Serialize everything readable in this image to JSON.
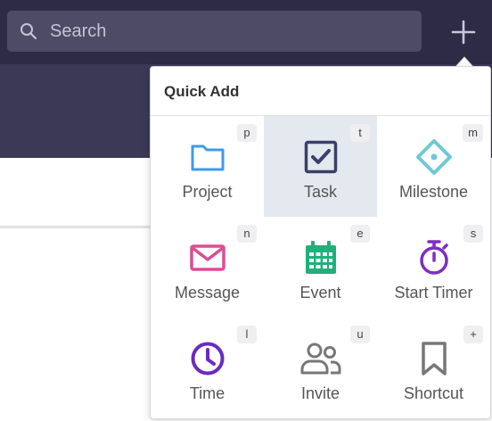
{
  "search": {
    "placeholder": "Search",
    "icon": "search-icon"
  },
  "header": {
    "add_icon": "plus-icon"
  },
  "quick_add": {
    "title": "Quick Add",
    "items": [
      {
        "label": "Project",
        "shortcut": "p",
        "icon": "folder-icon",
        "color": "#3d9be9",
        "active": false
      },
      {
        "label": "Task",
        "shortcut": "t",
        "icon": "checkbox-icon",
        "color": "#3a3f6a",
        "active": true
      },
      {
        "label": "Milestone",
        "shortcut": "m",
        "icon": "milestone-diamond-icon",
        "color": "#6ec9d4",
        "active": false
      },
      {
        "label": "Message",
        "shortcut": "n",
        "icon": "envelope-icon",
        "color": "#db4d94",
        "active": false
      },
      {
        "label": "Event",
        "shortcut": "e",
        "icon": "calendar-icon",
        "color": "#20b07a",
        "active": false
      },
      {
        "label": "Start Timer",
        "shortcut": "s",
        "icon": "stopwatch-icon",
        "color": "#7b2fc0",
        "active": false
      },
      {
        "label": "Time",
        "shortcut": "l",
        "icon": "clock-icon",
        "color": "#6a2bc0",
        "active": false
      },
      {
        "label": "Invite",
        "shortcut": "u",
        "icon": "people-icon",
        "color": "#777777",
        "active": false
      },
      {
        "label": "Shortcut",
        "shortcut": "+",
        "icon": "bookmark-icon",
        "color": "#777777",
        "active": false
      }
    ]
  }
}
